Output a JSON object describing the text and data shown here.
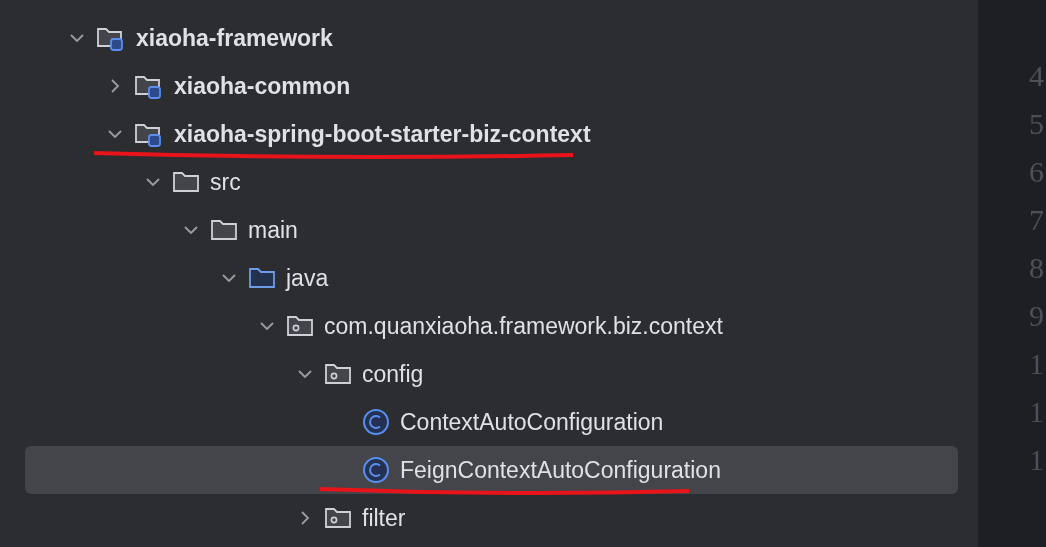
{
  "project_tree": [
    {
      "label": "xiaoha-framework",
      "kind": "module",
      "expanded": true,
      "selected": false,
      "children": [
        {
          "label": "xiaoha-common",
          "kind": "module",
          "expanded": false,
          "selected": false
        },
        {
          "label": "xiaoha-spring-boot-starter-biz-context",
          "kind": "module",
          "expanded": true,
          "selected": false,
          "underlined": true,
          "children": [
            {
              "label": "src",
              "kind": "folder",
              "expanded": true,
              "selected": false,
              "children": [
                {
                  "label": "main",
                  "kind": "folder",
                  "expanded": true,
                  "selected": false,
                  "children": [
                    {
                      "label": "java",
                      "kind": "source_folder",
                      "expanded": true,
                      "selected": false,
                      "children": [
                        {
                          "label": "com.quanxiaoha.framework.biz.context",
                          "kind": "package",
                          "expanded": true,
                          "selected": false,
                          "children": [
                            {
                              "label": "config",
                              "kind": "package",
                              "expanded": true,
                              "selected": false,
                              "children": [
                                {
                                  "label": "ContextAutoConfiguration",
                                  "kind": "class",
                                  "selected": false
                                },
                                {
                                  "label": "FeignContextAutoConfiguration",
                                  "kind": "class",
                                  "selected": true,
                                  "underlined": true
                                }
                              ]
                            },
                            {
                              "label": "filter",
                              "kind": "package",
                              "expanded": false,
                              "selected": false
                            }
                          ]
                        }
                      ]
                    }
                  ]
                }
              ]
            }
          ]
        }
      ]
    }
  ],
  "gutter": {
    "line_numbers": [
      "4",
      "5",
      "6",
      "7",
      "8",
      "9",
      "1",
      "1",
      "1"
    ]
  }
}
